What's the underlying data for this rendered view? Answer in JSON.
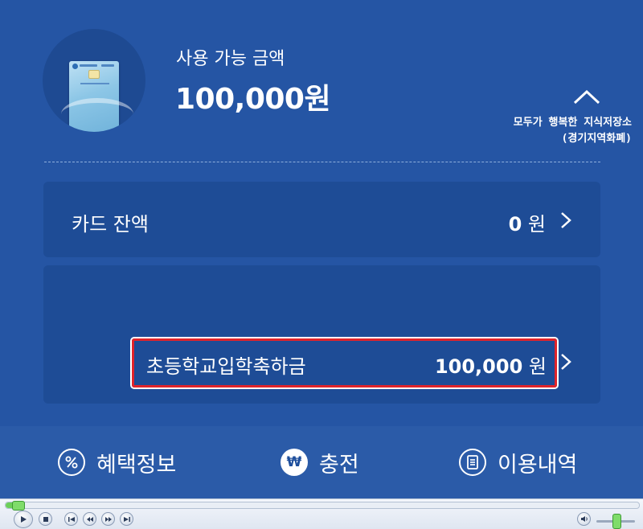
{
  "summary": {
    "available_label": "사용 가능 금액",
    "available_amount": "100,000원"
  },
  "slogan": {
    "line1": "모두가 행복한 지식저장소",
    "line2": "(경기지역화폐)"
  },
  "balance": {
    "label": "카드 잔액",
    "value": "0",
    "unit": "원"
  },
  "grants": [
    {
      "name": "초등학교입학축하금",
      "value": "100,000",
      "unit": "원"
    }
  ],
  "nav": {
    "benefits_label": "혜택정보",
    "charge_label": "충전",
    "charge_symbol": "₩",
    "history_label": "이용내역"
  },
  "colors": {
    "background": "#2555a4",
    "panel": "#1e4c96",
    "highlight": "#e0232a"
  },
  "icons": [
    "card-image",
    "chevron-up-icon",
    "chevron-right-icon",
    "percent-icon",
    "won-icon",
    "receipt-icon",
    "play-icon",
    "stop-icon",
    "previous-icon",
    "rewind-icon",
    "fast-forward-icon",
    "next-icon",
    "speaker-icon"
  ]
}
